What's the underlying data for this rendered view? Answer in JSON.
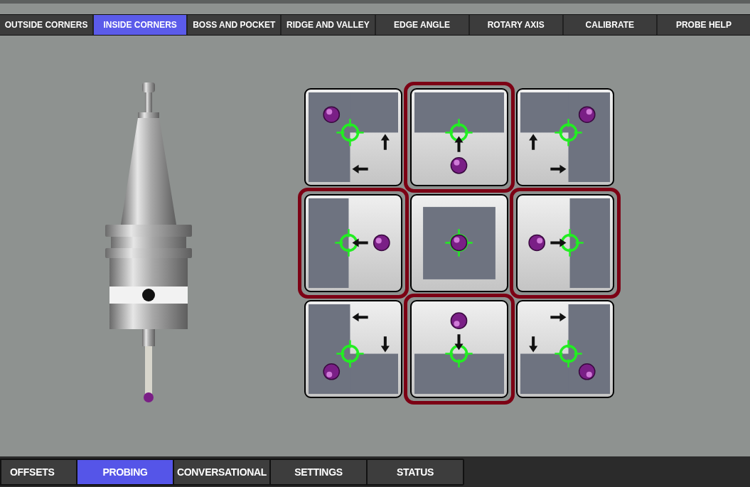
{
  "top_tabs": [
    {
      "label": "OUTSIDE CORNERS",
      "selected": false
    },
    {
      "label": "INSIDE CORNERS",
      "selected": true
    },
    {
      "label": "BOSS AND POCKET",
      "selected": false
    },
    {
      "label": "RIDGE AND VALLEY",
      "selected": false
    },
    {
      "label": "EDGE ANGLE",
      "selected": false
    },
    {
      "label": "ROTARY AXIS",
      "selected": false
    },
    {
      "label": "CALIBRATE",
      "selected": false
    },
    {
      "label": "PROBE HELP",
      "selected": false
    }
  ],
  "probe_buttons": [
    {
      "kind": "corner-top-left",
      "highlighted": false
    },
    {
      "kind": "edge-top",
      "highlighted": true
    },
    {
      "kind": "corner-top-right",
      "highlighted": false
    },
    {
      "kind": "edge-left",
      "highlighted": true
    },
    {
      "kind": "center",
      "highlighted": false
    },
    {
      "kind": "edge-right",
      "highlighted": true
    },
    {
      "kind": "corner-bottom-left",
      "highlighted": false
    },
    {
      "kind": "edge-bottom",
      "highlighted": true
    },
    {
      "kind": "corner-bottom-right",
      "highlighted": false
    }
  ],
  "bottom_tabs": [
    {
      "label": "OFFSETS",
      "selected": false
    },
    {
      "label": "PROBING",
      "selected": true
    },
    {
      "label": "CONVERSATIONAL",
      "selected": false
    },
    {
      "label": "SETTINGS",
      "selected": false
    },
    {
      "label": "STATUS",
      "selected": false
    }
  ]
}
